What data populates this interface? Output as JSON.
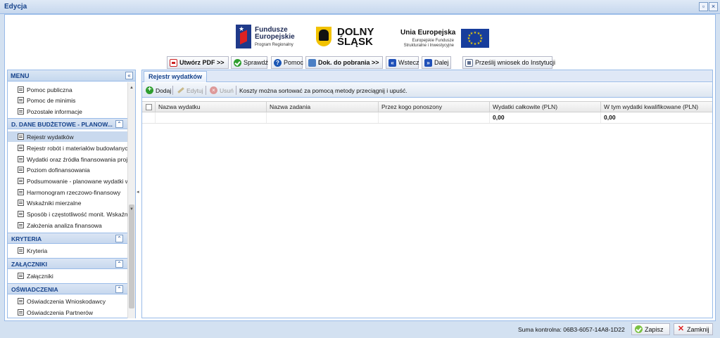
{
  "window": {
    "title": "Edycja"
  },
  "header": {
    "fe_line1": "Fundusze",
    "fe_line2": "Europejskie",
    "fe_sub": "Program Regionalny",
    "ds_line1": "DOLNY",
    "ds_line2": "ŚLĄSK",
    "ue_title": "Unia Europejska",
    "ue_sub1": "Europejskie Fundusze",
    "ue_sub2": "Strukturalne i Inwestycyjne"
  },
  "toolbar": {
    "pdf": "Utwórz PDF >>",
    "check": "Sprawdź",
    "help": "Pomoc",
    "download": "Dok. do pobrania >>",
    "back": "Wstecz",
    "next": "Dalej",
    "send": "Prześlij wniosek do Instytucji"
  },
  "menu": {
    "title": "MENU",
    "items_top": [
      "Pomoc publiczna",
      "Pomoc de minimis",
      "Pozostałe informacje"
    ],
    "section_d": "D. DANE BUDŻETOWE - PLANOW...",
    "items_d": [
      "Rejestr wydatków",
      "Rejestr robót i materiałów budowlanych",
      "Wydatki oraz źródła finansowania projektu",
      "Poziom dofinansowania",
      "Podsumowanie - planowane wydatki w",
      "Harmonogram rzeczowo-finansowy",
      "Wskaźniki mierzalne",
      "Sposób i częstotliwość monit. Wskaźn",
      "Założenia analiza finansowa"
    ],
    "section_k": "KRYTERIA",
    "items_k": [
      "Kryteria"
    ],
    "section_z": "ZAŁĄCZNIKI",
    "items_z": [
      "Załączniki"
    ],
    "section_o": "OŚWIADCZENIA",
    "items_o": [
      "Oświadczenia Wnioskodawcy",
      "Oświadczenia Partnerów"
    ]
  },
  "grid": {
    "tab": "Rejestr wydatków",
    "add": "Dodaj",
    "edit": "Edytuj",
    "delete": "Usuń",
    "hint": "Koszty można sortować za pomocą metody przeciągnij i upuść.",
    "columns": [
      "Nazwa wydatku",
      "Nazwa zadania",
      "Przez kogo ponoszony",
      "Wydatki całkowite (PLN)",
      "W tym wydatki kwalifikowane (PLN)"
    ],
    "totals": {
      "total": "0,00",
      "eligible": "0,00"
    }
  },
  "footer": {
    "checksum": "Suma kontrolna: 06B3-6057-14A8-1D22",
    "save": "Zapisz",
    "close": "Zamknij"
  }
}
